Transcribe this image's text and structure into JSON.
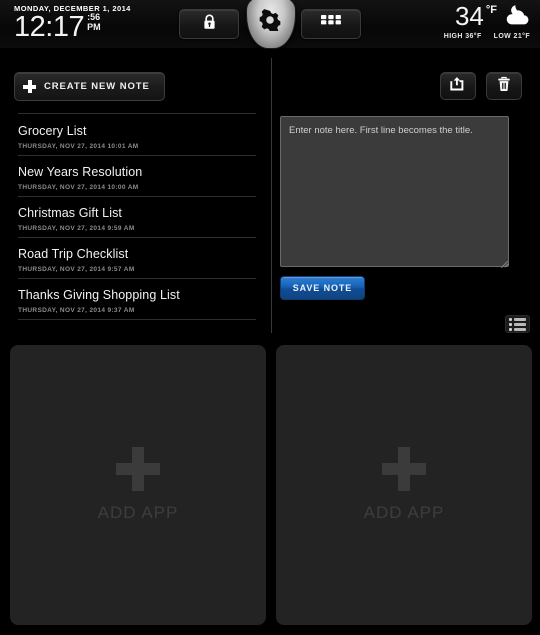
{
  "header": {
    "date": "MONDAY, DECEMBER 1, 2014",
    "time": "12:17",
    "seconds": ":56",
    "meridiem": "PM",
    "lock_icon": "lock-icon",
    "gear_icon": "gear-icon",
    "grid_icon": "grid-apps-icon",
    "weather": {
      "temperature": "34",
      "unit": "°F",
      "high": "HIGH 36°F",
      "low": "LOW 21°F",
      "condition_icon": "moon-cloud-icon"
    }
  },
  "notes_panel": {
    "create_button": "CREATE NEW NOTE",
    "create_icon": "plus-icon",
    "items": [
      {
        "title": "Grocery List",
        "timestamp": "THURSDAY, NOV 27, 2014 10:01 AM"
      },
      {
        "title": "New Years Resolution",
        "timestamp": "THURSDAY, NOV 27, 2014 10:00 AM"
      },
      {
        "title": "Christmas Gift List",
        "timestamp": "THURSDAY, NOV 27, 2014 9:59 AM"
      },
      {
        "title": "Road Trip Checklist",
        "timestamp": "THURSDAY, NOV 27, 2014 9:57 AM"
      },
      {
        "title": "Thanks Giving Shopping List",
        "timestamp": "THURSDAY, NOV 27, 2014 9:37 AM"
      }
    ]
  },
  "editor_panel": {
    "share_icon": "share-icon",
    "trash_icon": "trash-icon",
    "note_value": "",
    "note_placeholder": "Enter note here. First line becomes the title.",
    "save_button": "SAVE NOTE",
    "list_view_icon": "list-view-icon"
  },
  "app_slots": [
    {
      "label": "ADD APP",
      "icon": "plus-icon"
    },
    {
      "label": "ADD APP",
      "icon": "plus-icon"
    }
  ],
  "colors": {
    "background": "#000000",
    "panel": "#232323",
    "accent_blue": "#1761b4",
    "text_primary": "#f2f2f2",
    "text_muted": "#8c8c8c"
  }
}
